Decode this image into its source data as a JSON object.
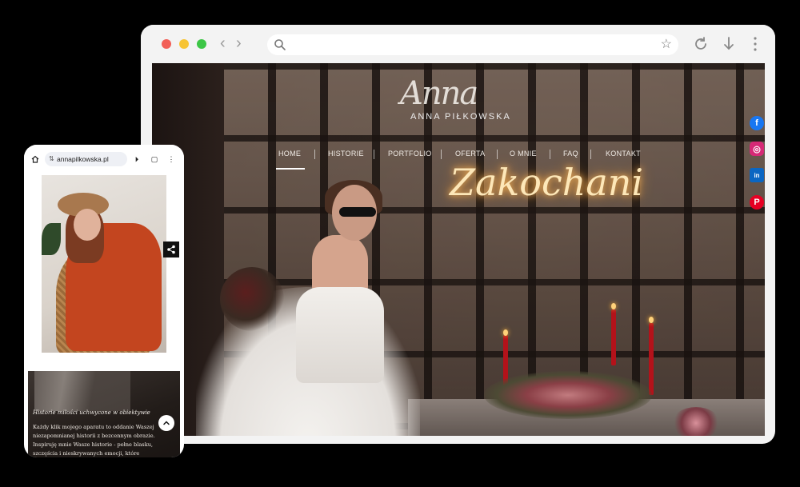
{
  "desktop": {
    "browser_chrome": {
      "url": "",
      "icons": [
        "search-icon",
        "star-icon",
        "reload-icon",
        "download-icon",
        "menu-icon"
      ]
    },
    "site": {
      "logo_script": "Anna",
      "logo_text": "ANNA PIŁKOWSKA",
      "nav": [
        "HOME",
        "HISTORIE",
        "PORTFOLIO",
        "OFERTA",
        "O MNIE",
        "FAQ",
        "KONTAKT"
      ],
      "active_nav": "HOME",
      "neon_sign": "Zakochani",
      "social": [
        {
          "name": "facebook-icon",
          "glyph": "f",
          "color": "#1877f2"
        },
        {
          "name": "instagram-icon",
          "glyph": "◎",
          "color": "#d62976"
        },
        {
          "name": "linkedin-icon",
          "glyph": "in",
          "color": "#0a66c2"
        },
        {
          "name": "pinterest-icon",
          "glyph": "P",
          "color": "#e60023"
        }
      ]
    }
  },
  "mobile": {
    "url": "annapilkowska.pl",
    "section_title": "Historie miłości uchwycone w obiektywie",
    "body_text": "Każdy klik mojego aparatu to oddanie Waszej niezapomnianej historii z bezcennym obrazie. Inspiruję mnie Wasze historie - pełne blasku, szczęścia i nieskrywanych emocji, które przenoszę w świat"
  }
}
